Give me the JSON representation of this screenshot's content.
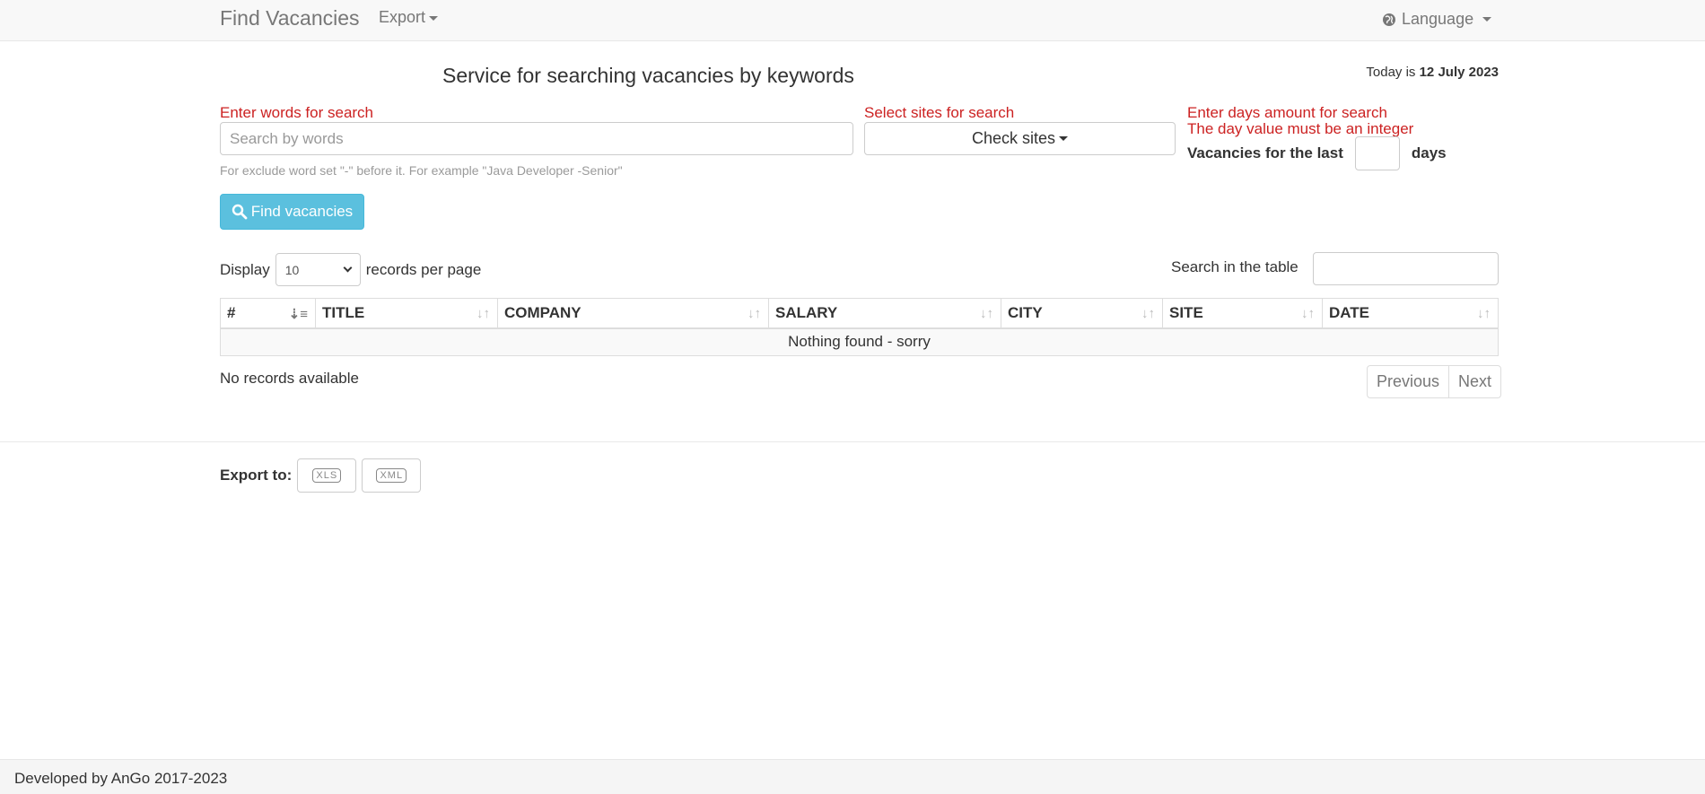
{
  "navbar": {
    "brand": "Find Vacancies",
    "export_label": "Export",
    "language_label": "Language"
  },
  "header": {
    "title": "Service for searching vacancies by keywords",
    "today_prefix": "Today is",
    "today_date": "12 July 2023"
  },
  "search": {
    "words_label": "Enter words for search",
    "placeholder": "Search by words",
    "value": "",
    "hint": "For exclude word set \"-\" before it. For example \"Java Developer -Senior\"",
    "sites_label": "Select sites for search",
    "sites_button": "Check sites",
    "days_label": "Enter days amount for search",
    "days_error": "The day value must be an integer",
    "days_prefix": "Vacancies for the last",
    "days_suffix": "days",
    "find_button": "Find vacancies"
  },
  "table_controls": {
    "display_label": "Display",
    "page_size": "10",
    "per_page_label": "records per page",
    "table_search_label": "Search in the table"
  },
  "table": {
    "columns": [
      "#",
      "TITLE",
      "COMPANY",
      "SALARY",
      "CITY",
      "SITE",
      "DATE"
    ],
    "empty_message": "Nothing found - sorry"
  },
  "pagination": {
    "info": "No records available",
    "previous": "Previous",
    "next": "Next"
  },
  "export": {
    "label": "Export to:",
    "xls": "XLS",
    "xml": "XML"
  },
  "footer": {
    "text": "Developed by AnGo 2017-2023"
  },
  "colors": {
    "accent": "#5bc0de",
    "error": "#cc2222"
  }
}
